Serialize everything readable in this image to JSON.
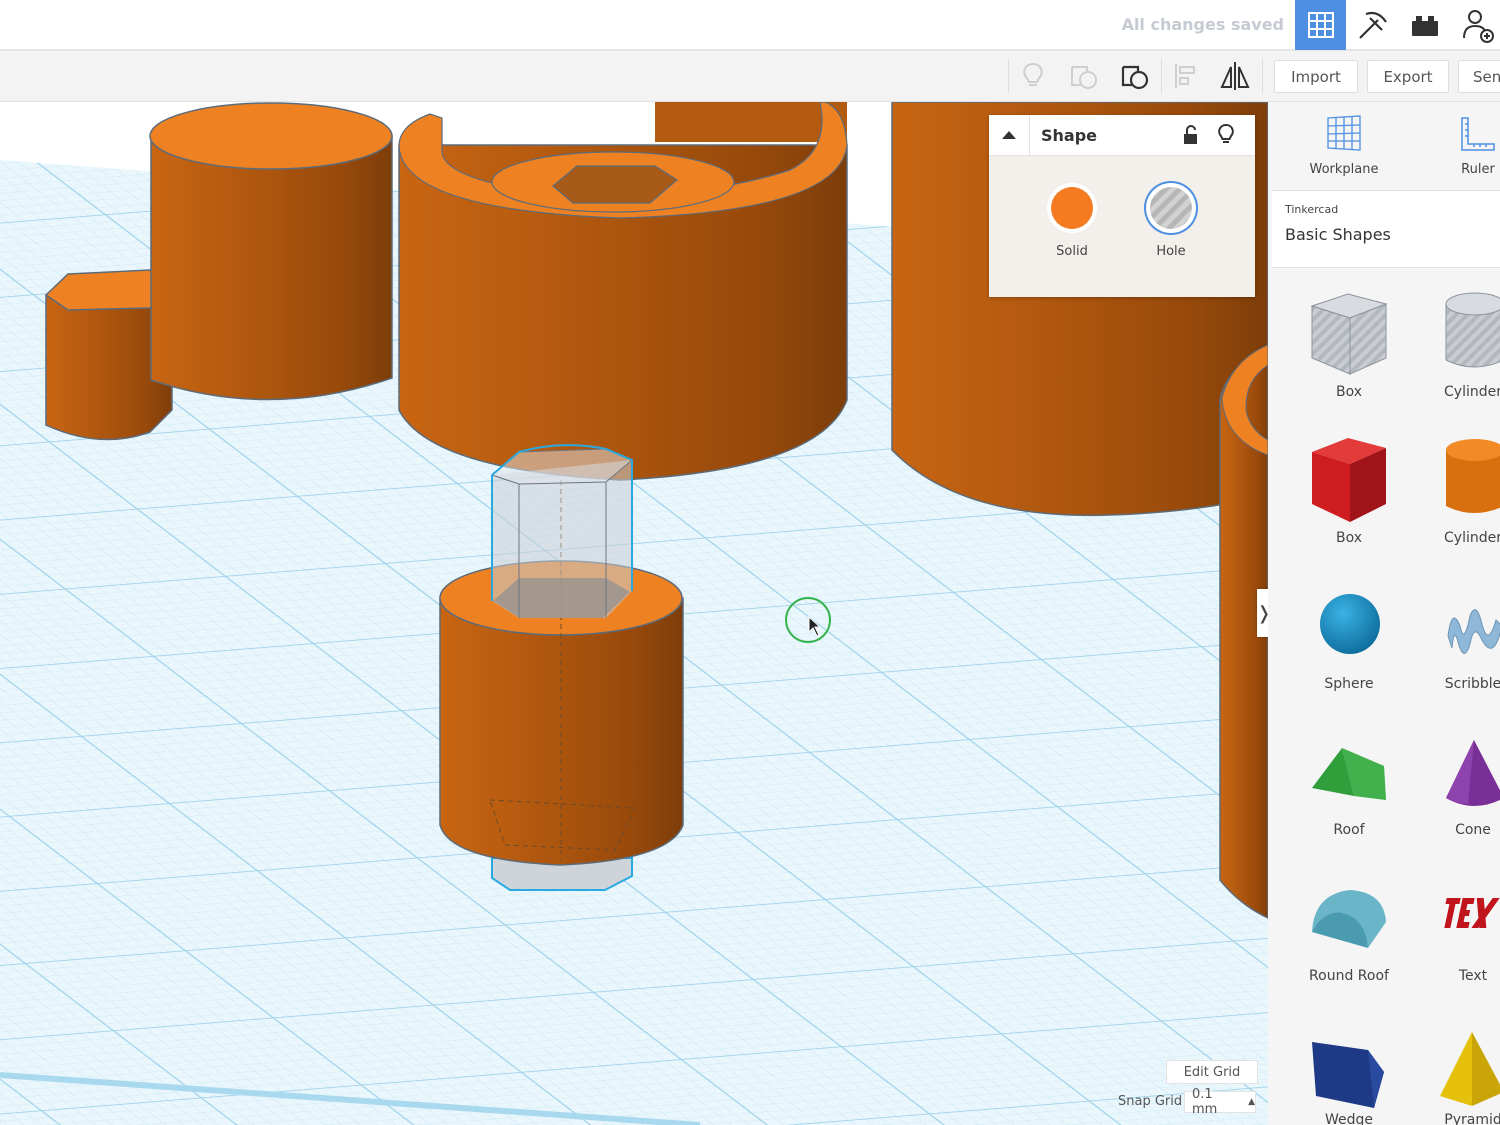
{
  "topbar": {
    "status": "All changes saved",
    "icons": [
      "grid-view-icon",
      "pickaxe-icon",
      "brick-icon",
      "add-user-icon"
    ]
  },
  "toolbar": {
    "icons": [
      "lightbulb-icon",
      "group-icon",
      "ungroup-icon",
      "align-icon",
      "mirror-icon"
    ],
    "import_label": "Import",
    "export_label": "Export",
    "send_label": "Sen"
  },
  "inspector": {
    "title": "Shape",
    "solid_label": "Solid",
    "hole_label": "Hole",
    "solid_color": "#f47b20"
  },
  "sidepanel": {
    "workplane_label": "Workplane",
    "ruler_label": "Ruler",
    "library_provider": "Tinkercad",
    "library_name": "Basic Shapes",
    "shapes": [
      {
        "label": "Box",
        "icon": "box-hole-icon"
      },
      {
        "label": "Cylinder",
        "icon": "cylinder-hole-icon"
      },
      {
        "label": "Box",
        "icon": "box-icon"
      },
      {
        "label": "Cylinder",
        "icon": "cylinder-icon"
      },
      {
        "label": "Sphere",
        "icon": "sphere-icon"
      },
      {
        "label": "Scribble",
        "icon": "scribble-icon"
      },
      {
        "label": "Roof",
        "icon": "roof-icon"
      },
      {
        "label": "Cone",
        "icon": "cone-icon"
      },
      {
        "label": "Round Roof",
        "icon": "round-roof-icon"
      },
      {
        "label": "Text",
        "icon": "text-icon"
      },
      {
        "label": "Wedge",
        "icon": "wedge-icon"
      },
      {
        "label": "Pyramid",
        "icon": "pyramid-icon"
      }
    ]
  },
  "grid": {
    "edit_grid_label": "Edit Grid",
    "snap_grid_label": "Snap Grid",
    "snap_value": "0.1 mm"
  },
  "colors": {
    "accent_blue": "#4e8fe1",
    "object_orange": "#e07d1f",
    "grid_blue": "#bfe3f2"
  }
}
